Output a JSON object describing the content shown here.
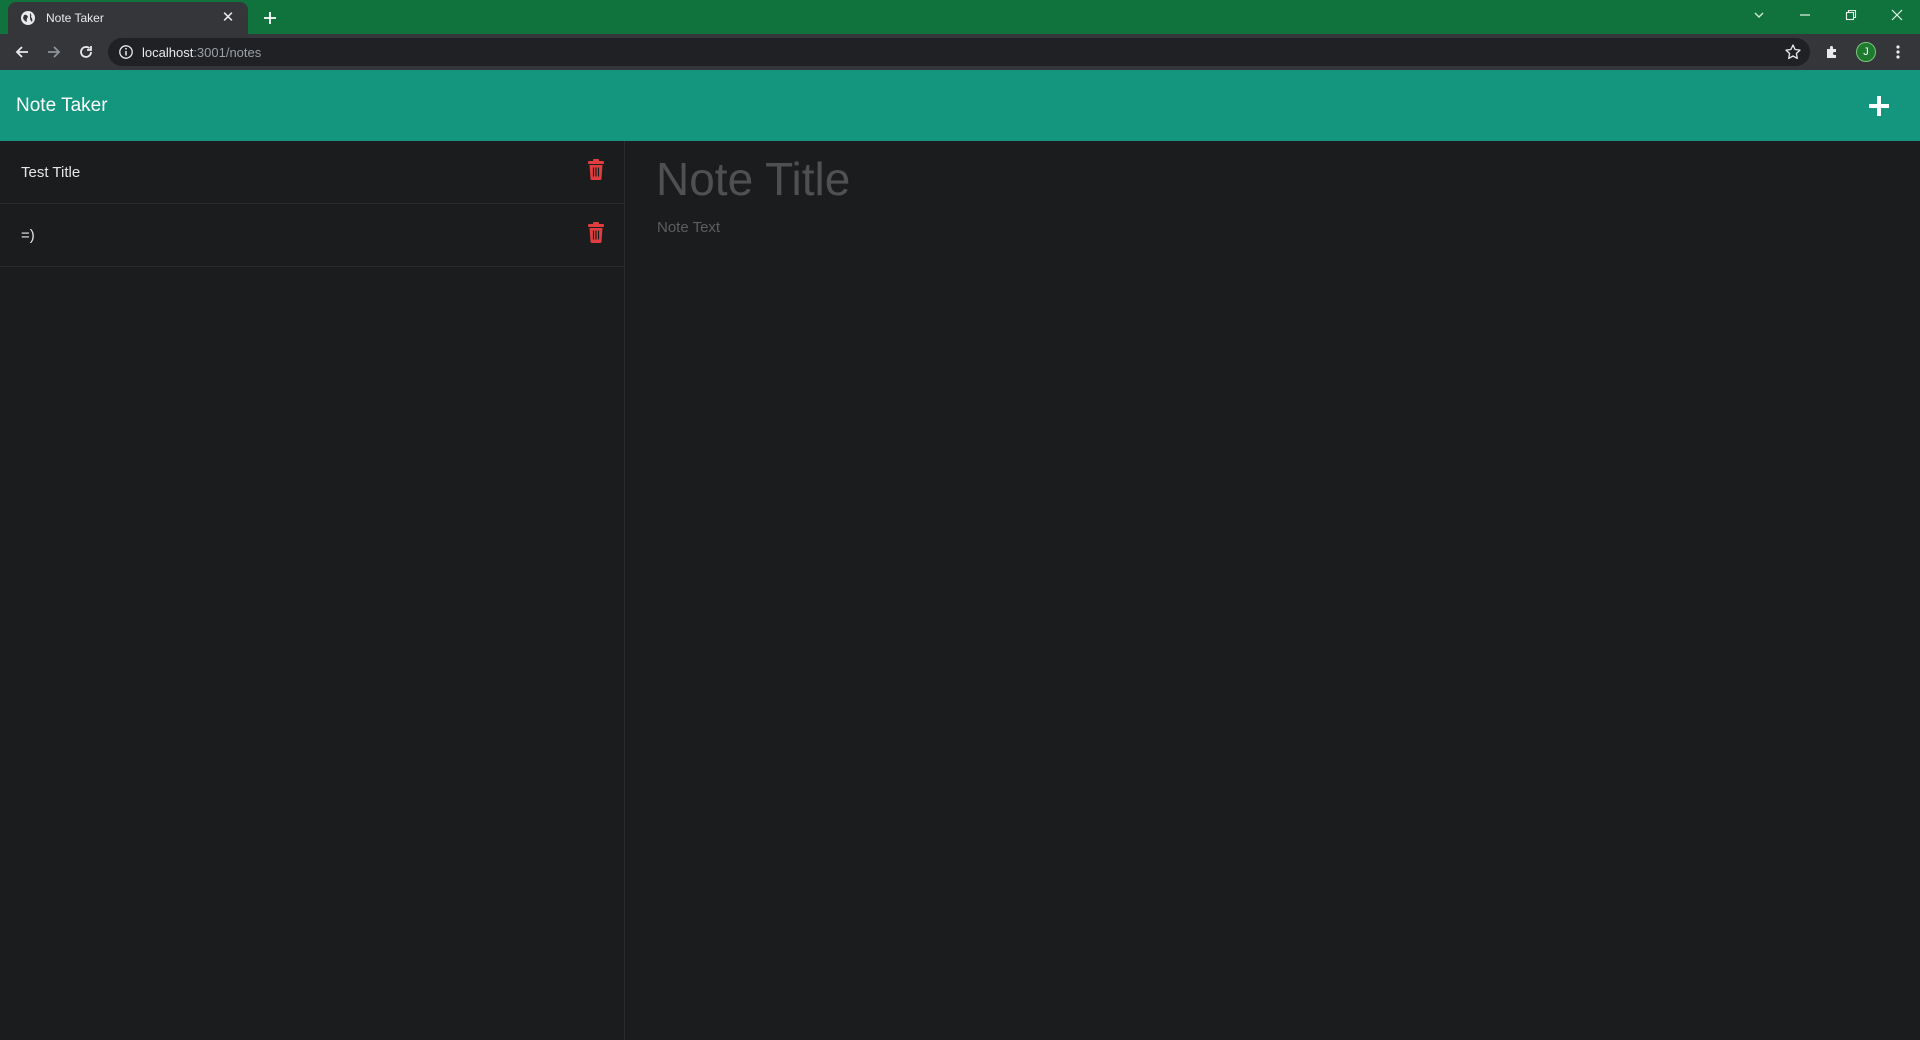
{
  "browser": {
    "tab": {
      "title": "Note Taker",
      "favicon": "globe-icon",
      "close": "✕"
    },
    "new_tab": "plus-icon",
    "url": {
      "host": "localhost",
      "path": ":3001/notes"
    },
    "avatar_letter": "J",
    "colors": {
      "tabstrip": "#10733d",
      "toolbar": "#35363a"
    }
  },
  "app": {
    "brand": "Note Taker",
    "add_icon": "plus-icon",
    "colors": {
      "navbar": "#13967d",
      "delete": "#e03e3e",
      "background": "#1b1c1e"
    }
  },
  "sidebar": {
    "notes": [
      {
        "title": "Test Title"
      },
      {
        "title": "=)"
      }
    ]
  },
  "editor": {
    "title_placeholder": "Note Title",
    "text_placeholder": "Note Text"
  }
}
